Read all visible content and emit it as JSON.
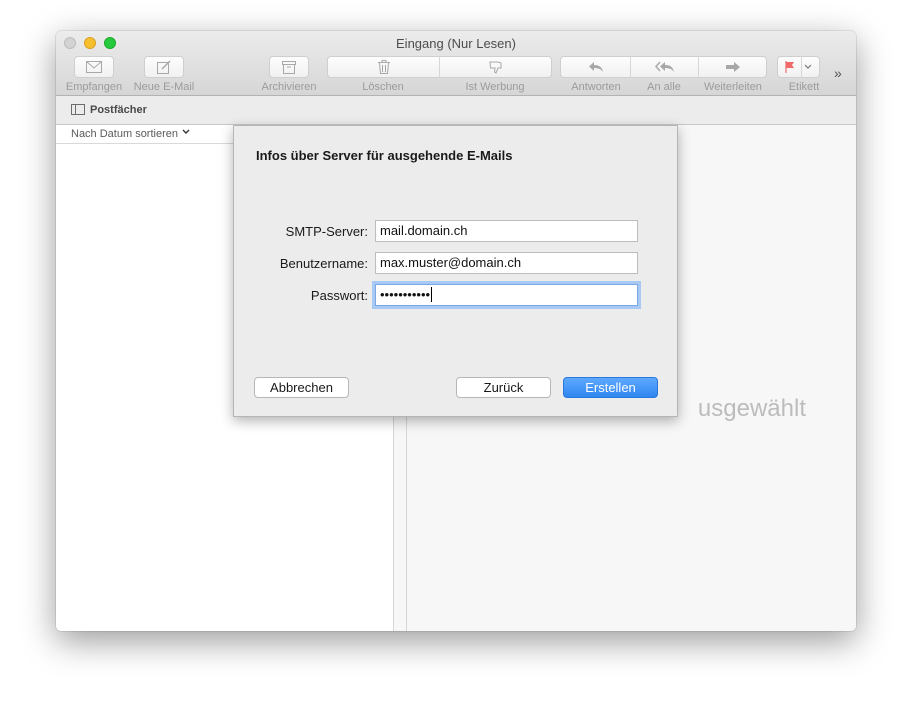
{
  "window": {
    "title": "Eingang (Nur Lesen)"
  },
  "toolbar": {
    "get_mail": "Empfangen",
    "new_mail": "Neue E-Mail",
    "archive": "Archivieren",
    "delete": "Löschen",
    "junk": "Ist Werbung",
    "reply": "Antworten",
    "reply_all": "An alle",
    "forward": "Weiterleiten",
    "flag": "Etikett",
    "more": "»",
    "icons": {
      "get_mail": "envelope-icon",
      "new_mail": "compose-icon",
      "archive": "archive-box-icon",
      "delete": "trash-icon",
      "junk": "thumbs-down-icon",
      "reply": "reply-arrow-icon",
      "reply_all": "reply-all-arrows-icon",
      "forward": "forward-arrow-icon",
      "flag": "flag-icon"
    },
    "flag_color": "#f06a6a"
  },
  "favorites": {
    "mailboxes": "Postfächer"
  },
  "list": {
    "sort": "Nach Datum sortieren"
  },
  "viewer": {
    "empty_text": "usgewählt"
  },
  "dialog": {
    "title": "Infos über Server für ausgehende E-Mails",
    "smtp_label": "SMTP-Server:",
    "smtp_value": "mail.domain.ch",
    "user_label": "Benutzername:",
    "user_value": "max.muster@domain.ch",
    "password_label": "Passwort:",
    "password_value": "•••••••••••",
    "cancel": "Abbrechen",
    "back": "Zurück",
    "create": "Erstellen",
    "accent": "#2f86f0"
  }
}
